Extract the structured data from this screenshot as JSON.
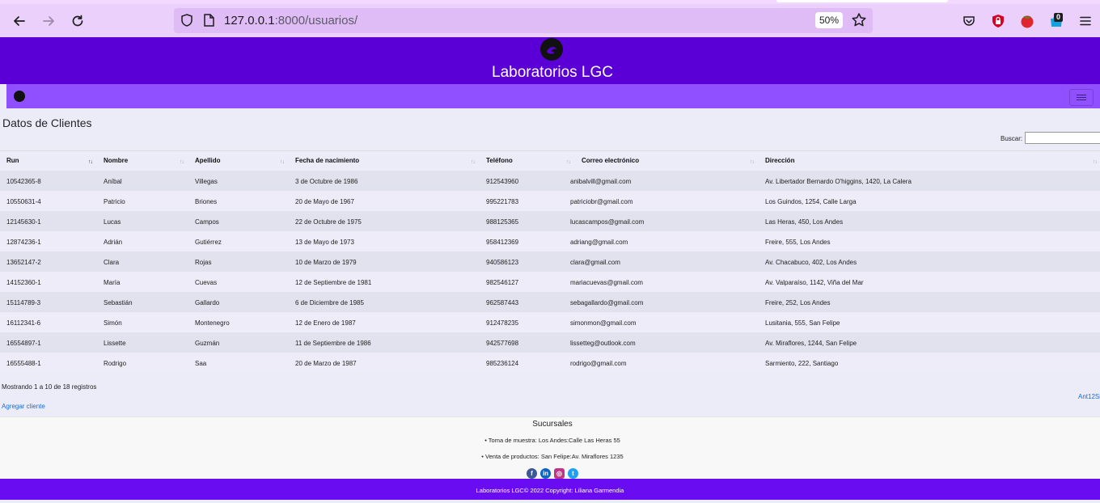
{
  "browser": {
    "url_host": "127.0.0.1",
    "url_rest": ":8000/usuarios/",
    "zoom": "50%",
    "badge_count": "0"
  },
  "site": {
    "title": "Laboratorios LGC"
  },
  "main": {
    "title": "Datos de Clientes",
    "search_label": "Buscar:",
    "search_value": "",
    "columns": [
      "Run",
      "Nombre",
      "Apellido",
      "Fecha de nacimiento",
      "Teléfono",
      "Correo electrónico",
      "Dirección"
    ],
    "rows": [
      [
        "10542365-8",
        "Aníbal",
        "Villegas",
        "3 de Octubre de 1986",
        "912543960",
        "anibalvill@gmail.com",
        "Av. Libertador Bernardo O'higgins, 1420, La Calera"
      ],
      [
        "10550631-4",
        "Patricio",
        "Briones",
        "20 de Mayo de 1967",
        "995221783",
        "patriciobr@gmail.com",
        "Los Guindos, 1254, Calle Larga"
      ],
      [
        "12145630-1",
        "Lucas",
        "Campos",
        "22 de Octubre de 1975",
        "988125365",
        "lucascampos@gmail.com",
        "Las Heras, 450, Los Andes"
      ],
      [
        "12874236-1",
        "Adrián",
        "Gutiérrez",
        "13 de Mayo de 1973",
        "958412369",
        "adriang@gmail.com",
        "Freire, 555, Los Andes"
      ],
      [
        "13652147-2",
        "Clara",
        "Rojas",
        "10 de Marzo de 1979",
        "940586123",
        "clara@gmail.com",
        "Av. Chacabuco, 402, Los Andes"
      ],
      [
        "14152360-1",
        "María",
        "Cuevas",
        "12 de Septiembre de 1981",
        "982546127",
        "mariacuevas@gmail.com",
        "Av. Valparaíso, 1142, Viña del Mar"
      ],
      [
        "15114789-3",
        "Sebastián",
        "Gallardo",
        "6 de Diciembre de 1985",
        "962587443",
        "sebagallardo@gmail.com",
        "Freire, 252, Los Andes"
      ],
      [
        "16112341-6",
        "Simón",
        "Montenegro",
        "12 de Enero de 1987",
        "912478235",
        "simonmon@gmail.com",
        "Lusitania, 555, San Felipe"
      ],
      [
        "16554897-1",
        "Lissette",
        "Guzmán",
        "11 de Septiembre de 1986",
        "942577698",
        "lissetteg@outlook.com",
        "Av. Miraflores, 1244, San Felipe"
      ],
      [
        "16555488-1",
        "Rodrigo",
        "Saa",
        "20 de Marzo de 1987",
        "985236124",
        "rodrigo@gmail.com",
        "Sarmiento, 222, Santiago"
      ]
    ],
    "info": "Mostrando 1 a 10 de 18 registros",
    "pager": "Ant12Si",
    "add_link": "Agregar cliente"
  },
  "footer": {
    "sucursales_title": "Sucursales",
    "sucursales": [
      "Toma de muestra: Los Andes:Calle Las Heras 55",
      "Venta de productos: San Felipe:Av. Miraflores 1235"
    ],
    "socials": [
      "facebook-icon",
      "linkedin-icon",
      "instagram-icon",
      "twitter-icon"
    ],
    "copyright": "Laboratorios LGC© 2022 Copyright: Liliana Garmendia"
  },
  "colors": {
    "header": "#5a00d6",
    "navbar": "#9150ff",
    "footer_bar": "#6a0cf2",
    "link": "#1a6bd6"
  }
}
